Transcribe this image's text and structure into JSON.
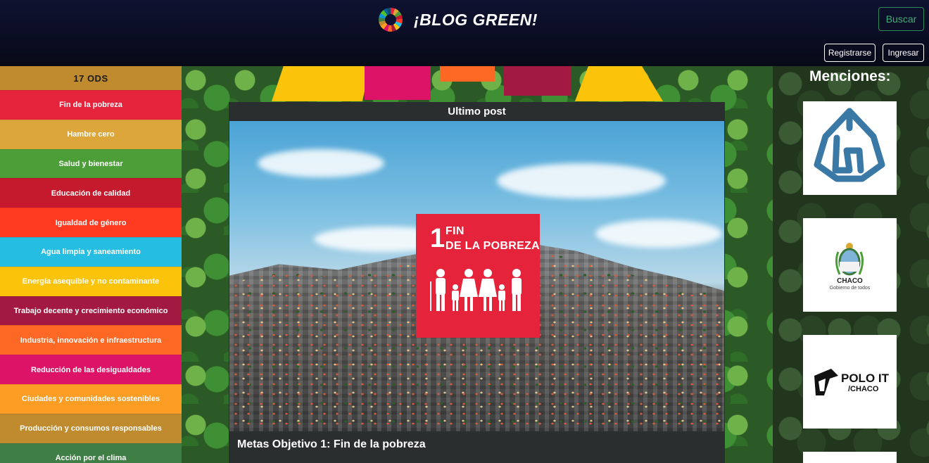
{
  "header": {
    "brand_title": "¡BLOG GREEN!",
    "logo_icon": "sdg-wheel-icon",
    "search_button": "Buscar",
    "register_button": "Registrarse",
    "login_button": "Ingresar"
  },
  "sidebar": {
    "title": "17 ODS",
    "items": [
      {
        "label": "Fin de la pobreza",
        "color": "#e5243b"
      },
      {
        "label": "Hambre cero",
        "color": "#dda63a"
      },
      {
        "label": "Salud y bienestar",
        "color": "#4c9f38"
      },
      {
        "label": "Educación de calidad",
        "color": "#c5192d"
      },
      {
        "label": "Igualdad de género",
        "color": "#ff3a21"
      },
      {
        "label": "Agua limpia y saneamiento",
        "color": "#26bde2"
      },
      {
        "label": "Energía asequible y no contaminante",
        "color": "#fcc30b"
      },
      {
        "label": "Trabajo decente y crecimiento económico",
        "color": "#a21942"
      },
      {
        "label": "Industria, innovación e infraestructura",
        "color": "#fd6925"
      },
      {
        "label": "Reducción de las desigualdades",
        "color": "#dd1367"
      },
      {
        "label": "Ciudades y comunidades sostenibles",
        "color": "#fd9d24"
      },
      {
        "label": "Producción y consumos responsables",
        "color": "#bf8b2e"
      },
      {
        "label": "Acción por el clima",
        "color": "#3f7e44"
      }
    ]
  },
  "post": {
    "heading": "Ultimo post",
    "badge_number": "1",
    "badge_text_line1": "FIN",
    "badge_text_line2": "DE LA POBREZA",
    "title": "Metas Objetivo 1: Fin de la pobreza"
  },
  "mentions": {
    "title": "Menciones:",
    "items": [
      {
        "icon": "institution-logo-icon"
      },
      {
        "icon": "chaco-coat-of-arms-icon",
        "name": "CHACO",
        "tagline": "Gobierno de todos"
      },
      {
        "icon": "polo-it-logo-icon",
        "line1": "POLO IT",
        "line2": "/CHACO"
      }
    ]
  }
}
